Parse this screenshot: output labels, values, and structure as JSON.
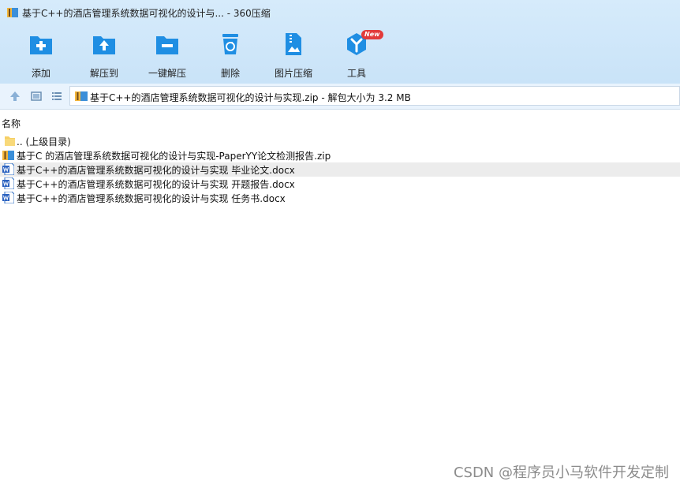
{
  "window": {
    "title": "基于C++的酒店管理系统数据可视化的设计与... - 360压缩"
  },
  "toolbar": {
    "items": [
      {
        "label": "添加",
        "icon": "add-icon"
      },
      {
        "label": "解压到",
        "icon": "extract-to-icon"
      },
      {
        "label": "一键解压",
        "icon": "one-click-extract-icon"
      },
      {
        "label": "删除",
        "icon": "delete-icon"
      },
      {
        "label": "图片压缩",
        "icon": "image-compress-icon"
      },
      {
        "label": "工具",
        "icon": "tools-icon",
        "badge": "New"
      }
    ]
  },
  "address": {
    "text": "基于C++的酒店管理系统数据可视化的设计与实现.zip - 解包大小为 3.2 MB"
  },
  "list": {
    "column_name": "名称",
    "rows": [
      {
        "name": ".. (上级目录)",
        "type": "folder"
      },
      {
        "name": "基于C  的酒店管理系统数据可视化的设计与实现-PaperYY论文检测报告.zip",
        "type": "zip"
      },
      {
        "name": "基于C++的酒店管理系统数据可视化的设计与实现 毕业论文.docx",
        "type": "docx",
        "selected": true
      },
      {
        "name": "基于C++的酒店管理系统数据可视化的设计与实现 开题报告.docx",
        "type": "docx"
      },
      {
        "name": "基于C++的酒店管理系统数据可视化的设计与实现 任务书.docx",
        "type": "docx"
      }
    ]
  },
  "watermark": "CSDN @程序员小马软件开发定制",
  "colors": {
    "toolbar_bg": "#c9e3f8",
    "icon_blue": "#1f8ee3",
    "badge_red": "#e23b3b",
    "selected_row": "#ececec"
  }
}
